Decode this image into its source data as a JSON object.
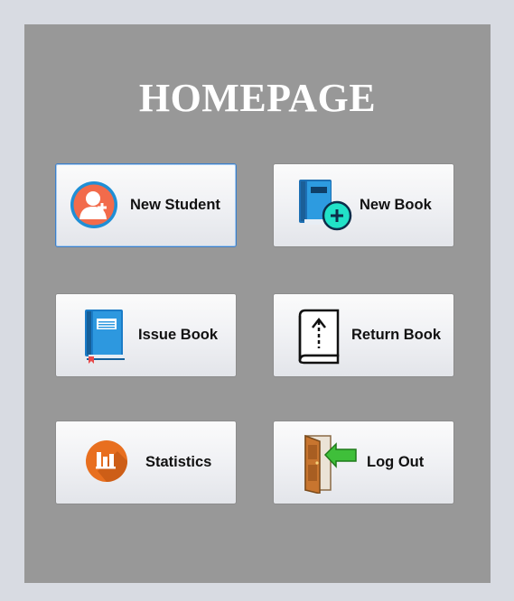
{
  "page": {
    "title": "HOMEPAGE"
  },
  "buttons": {
    "new_student": {
      "label": "New Student",
      "icon": "add-user-icon"
    },
    "new_book": {
      "label": "New Book",
      "icon": "add-book-icon"
    },
    "issue_book": {
      "label": "Issue Book",
      "icon": "book-icon"
    },
    "return_book": {
      "label": "Return Book",
      "icon": "return-book-icon"
    },
    "statistics": {
      "label": "Statistics",
      "icon": "bar-chart-icon"
    },
    "log_out": {
      "label": "Log Out",
      "icon": "exit-door-icon"
    }
  },
  "colors": {
    "panel": "#989898",
    "window": "#d8dbe2",
    "title": "#ffffff",
    "focus_border": "#3c7fc9"
  }
}
